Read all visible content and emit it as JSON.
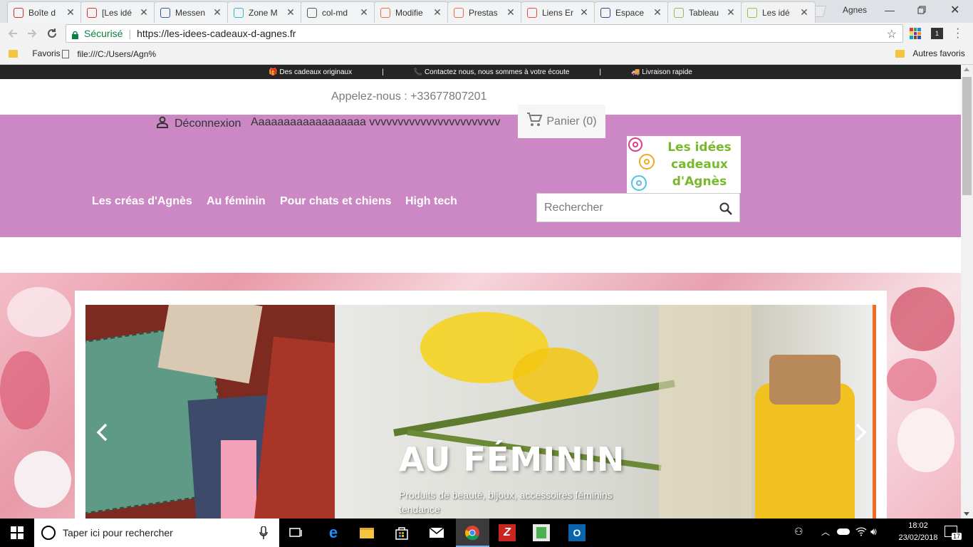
{
  "browser": {
    "tabs": [
      {
        "title": "Boîte d",
        "icon": "gmail-icon",
        "color": "#d93025"
      },
      {
        "title": "[Les idé",
        "icon": "gmail-icon",
        "color": "#d93025"
      },
      {
        "title": "Messen",
        "icon": "facebook-icon",
        "color": "#3b5998"
      },
      {
        "title": "Zone M",
        "icon": "p-circle-icon",
        "color": "#2fb5d2"
      },
      {
        "title": "col-md",
        "icon": "github-icon",
        "color": "#555555"
      },
      {
        "title": "Modifie",
        "icon": "prestashop-icon",
        "color": "#f26b3a"
      },
      {
        "title": "Prestas",
        "icon": "prestashop-icon",
        "color": "#f26b3a"
      },
      {
        "title": "Liens Er",
        "icon": "red-square-icon",
        "color": "#e84c3d"
      },
      {
        "title": "Espace",
        "icon": "blue-box-icon",
        "color": "#2b4a8a"
      },
      {
        "title": "Tableau",
        "icon": "document-icon",
        "color": "#8bc34a"
      },
      {
        "title": "Les idé",
        "icon": "document-icon",
        "color": "#8bc34a",
        "active": true
      }
    ],
    "profile_name": "Agnes",
    "secure_label": "Sécurisé",
    "url": "https://les-idees-cadeaux-d-agnes.fr",
    "bookmarks": [
      {
        "label": "Favoris",
        "icon": "folder-icon"
      },
      {
        "label": "file:///C:/Users/Agn%",
        "icon": "file-icon"
      }
    ],
    "other_bookmarks": "Autres favoris"
  },
  "site": {
    "top_strip": [
      {
        "icon": "gift-icon",
        "text": "🎁 Des cadeaux originaux"
      },
      {
        "sep": "|"
      },
      {
        "icon": "phone-icon",
        "text": "📞 Contactez nous, nous sommes à votre écoute"
      },
      {
        "sep": "|"
      },
      {
        "icon": "truck-icon",
        "text": "🚚 Livraison rapide"
      }
    ],
    "phone_text": "Appelez-nous : +33677807201",
    "logout_label": "Déconnexion",
    "user_name": "Aaaaaaaaaaaaaaaaaa vvvvvvvvvvvvvvvvvvvvvvv",
    "cart_label": "Panier (0)",
    "logo_text": [
      "Les idées",
      "cadeaux",
      "d'Agnès"
    ],
    "menu": [
      "Les créas d'Agnès",
      "Au féminin",
      "Pour chats et chiens",
      "High tech"
    ],
    "search_placeholder": "Rechercher",
    "slide": {
      "title": "AU FÉMININ",
      "caption": "Produits de beauté, bijoux, accessoires féminins tendance"
    },
    "colors": {
      "header_pink": "#cc88c4",
      "strip": "#252525",
      "logo_green": "#79b82c"
    }
  },
  "taskbar": {
    "search_placeholder": "Taper ici pour rechercher",
    "time": "18:02",
    "date": "23/02/2018",
    "notifications": "17"
  }
}
